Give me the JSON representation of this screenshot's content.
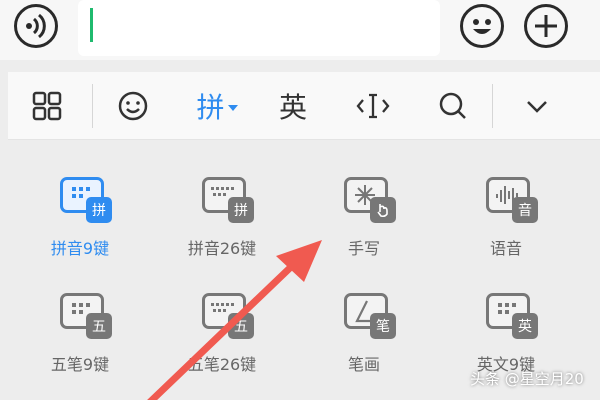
{
  "chat_bar": {
    "input_value": "",
    "voice_icon": "voice-icon",
    "emoji_icon": "emoji-icon",
    "plus_icon": "plus-icon"
  },
  "toolbar": {
    "items": [
      {
        "id": "grid",
        "icon": "grid-icon"
      },
      {
        "id": "emoji",
        "icon": "smile-icon"
      },
      {
        "id": "pinyin",
        "label": "拼",
        "active": true
      },
      {
        "id": "english",
        "label": "英"
      },
      {
        "id": "cursor",
        "icon": "cursor-move-icon"
      },
      {
        "id": "search",
        "icon": "search-icon"
      },
      {
        "id": "collapse",
        "icon": "chevron-down-icon"
      }
    ]
  },
  "modes": [
    {
      "label": "拼音9键",
      "badge": "拼",
      "icon": "keyboard-9-icon",
      "active": true
    },
    {
      "label": "拼音26键",
      "badge": "拼",
      "icon": "keyboard-26-icon"
    },
    {
      "label": "手写",
      "icon": "handwriting-icon"
    },
    {
      "label": "语音",
      "badge": "音",
      "icon": "voice-input-icon"
    },
    {
      "label": "五笔9键",
      "badge": "五",
      "icon": "keyboard-wubi9-icon"
    },
    {
      "label": "五笔26键",
      "badge": "五",
      "icon": "keyboard-wubi26-icon"
    },
    {
      "label": "笔画",
      "badge": "笔",
      "icon": "stroke-icon"
    },
    {
      "label": "英文9键",
      "badge": "英",
      "icon": "keyboard-english9-icon"
    }
  ],
  "watermark": "头条 @星空月20",
  "colors": {
    "accent": "#2f8cf0",
    "caret": "#1fba6e",
    "arrow": "#f05a50"
  }
}
